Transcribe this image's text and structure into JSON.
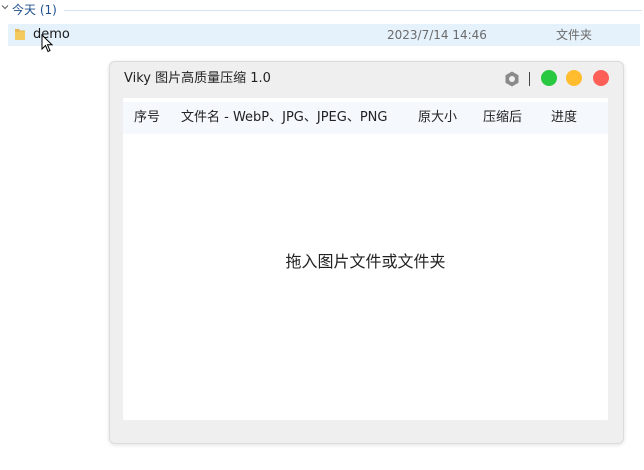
{
  "explorer": {
    "group_label": "今天 (1)",
    "file": {
      "name": "demo",
      "date": "2023/7/14 14:46",
      "type": "文件夹"
    }
  },
  "app": {
    "title": "Viky 图片高质量压缩 1.0",
    "controls": {
      "green": "#28c840",
      "yellow": "#febc2e",
      "red": "#fe5f57"
    },
    "table": {
      "columns": [
        "序号",
        "文件名 - WebP、JPG、JPEG、PNG",
        "原大小",
        "压缩后",
        "进度"
      ]
    },
    "drop_hint": "拖入图片文件或文件夹"
  }
}
